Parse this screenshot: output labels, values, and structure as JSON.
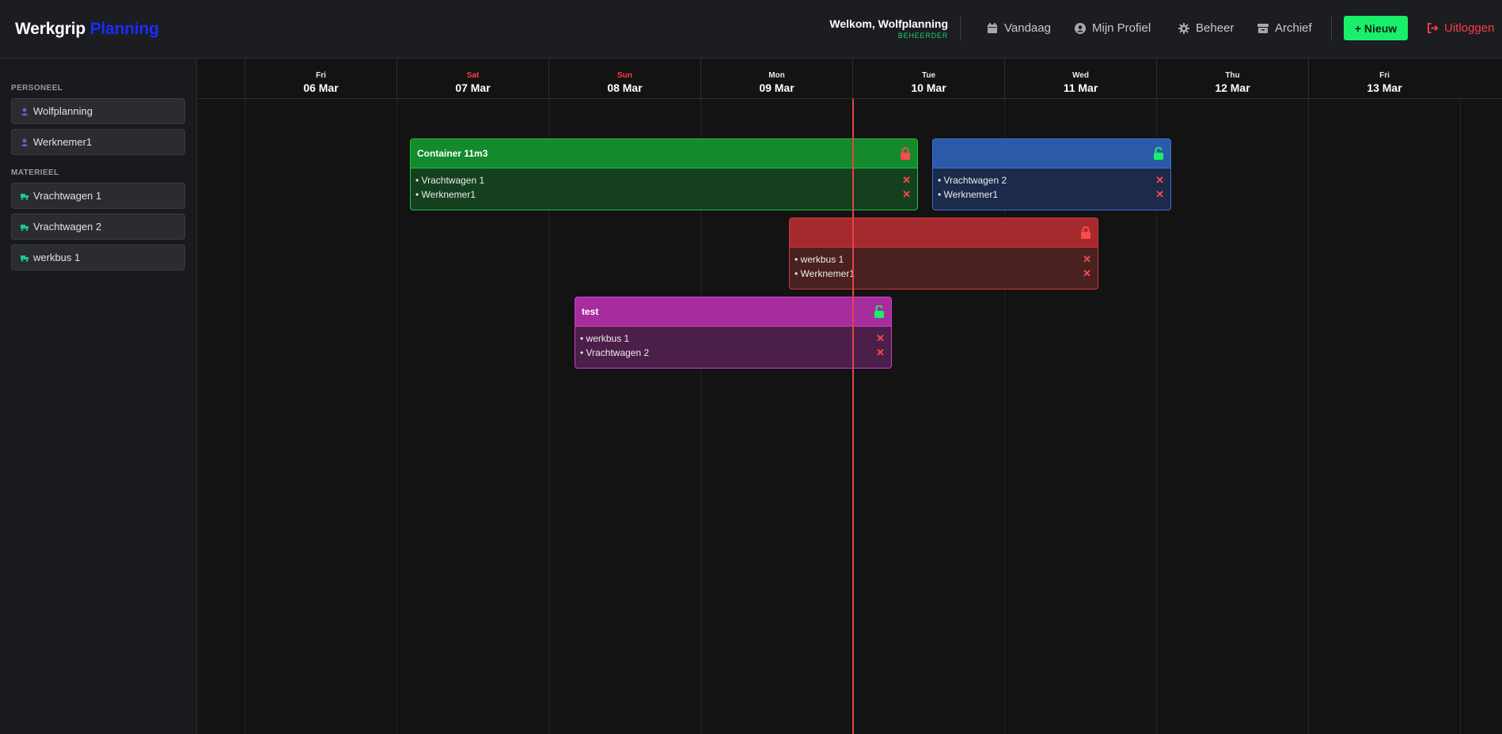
{
  "header": {
    "brand_main": "Werkgrip",
    "brand_accent": "Planning",
    "welcome": "Welkom, Wolfplanning",
    "role": "BEHEERDER",
    "nav": {
      "today": "Vandaag",
      "profile": "Mijn Profiel",
      "admin": "Beheer",
      "archive": "Archief"
    },
    "new_button": "+ Nieuw",
    "logout": "Uitloggen"
  },
  "sidebar": {
    "personnel_title": "PERSONEEL",
    "personnel": [
      {
        "label": "Wolfplanning",
        "icon": "user-icon"
      },
      {
        "label": "Werknemer1",
        "icon": "user-icon"
      }
    ],
    "material_title": "MATERIEEL",
    "material": [
      {
        "label": "Vrachtwagen 1",
        "icon": "truck-icon"
      },
      {
        "label": "Vrachtwagen 2",
        "icon": "truck-icon"
      },
      {
        "label": "werkbus 1",
        "icon": "truck-icon"
      }
    ]
  },
  "timeline": {
    "days": [
      {
        "name": "Fri",
        "date": "06 Mar",
        "weekend": false
      },
      {
        "name": "Sat",
        "date": "07 Mar",
        "weekend": true
      },
      {
        "name": "Sun",
        "date": "08 Mar",
        "weekend": true
      },
      {
        "name": "Mon",
        "date": "09 Mar",
        "weekend": false
      },
      {
        "name": "Tue",
        "date": "10 Mar",
        "weekend": false
      },
      {
        "name": "Wed",
        "date": "11 Mar",
        "weekend": false
      },
      {
        "name": "Thu",
        "date": "12 Mar",
        "weekend": false
      },
      {
        "name": "Fri",
        "date": "13 Mar",
        "weekend": false
      }
    ]
  },
  "events": [
    {
      "title": "Container 11m3",
      "locked": true,
      "color": "#138a2d",
      "items": [
        "• Vrachtwagen 1",
        "• Werknemer1"
      ]
    },
    {
      "title": "",
      "locked": false,
      "color": "#2c5aa8",
      "items": [
        "• Vrachtwagen 2",
        "• Werknemer1"
      ]
    },
    {
      "title": "",
      "locked": true,
      "color": "#a52a2d",
      "items": [
        "• werkbus 1",
        "• Werknemer1"
      ]
    },
    {
      "title": "test",
      "locked": false,
      "color": "#a72d9e",
      "items": [
        "• werkbus 1",
        "• Vrachtwagen 2"
      ]
    }
  ],
  "colors": {
    "accent_brand": "#1a2cff",
    "new_button": "#19ef6a",
    "logout": "#ff3b45",
    "now_line": "#e14446",
    "unlock_icon": "#19ef6a",
    "lock_icon": "#ff4a4a"
  },
  "remove_glyph": "✕"
}
